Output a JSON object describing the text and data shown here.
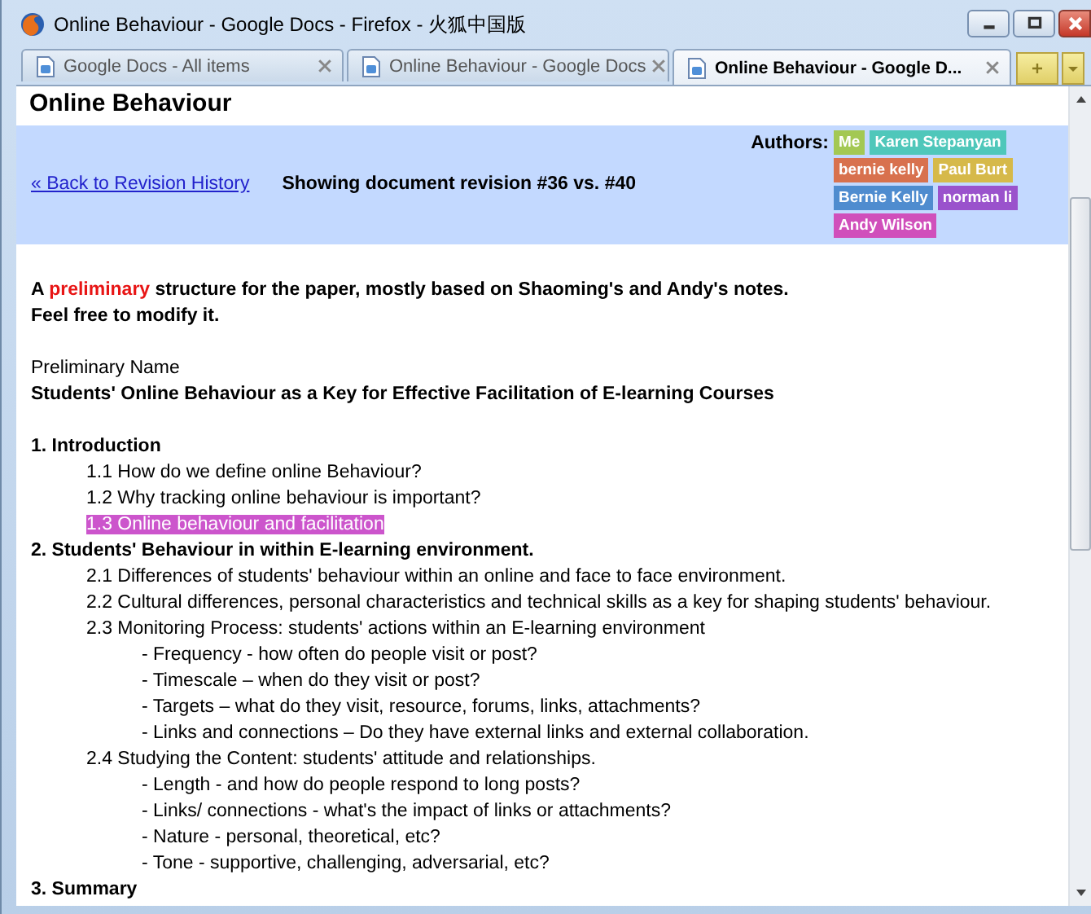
{
  "window": {
    "title": "Online Behaviour - Google Docs - Firefox - 火狐中国版"
  },
  "tabs": [
    {
      "label": "Google Docs - All items",
      "selected": false
    },
    {
      "label": "Online Behaviour - Google Docs",
      "selected": false
    },
    {
      "label": "Online Behaviour - Google D...",
      "selected": true
    }
  ],
  "page": {
    "heading": "Online Behaviour",
    "revision_bar": {
      "back_link": "« Back to Revision History",
      "revision": "Showing document revision #36 vs. #40",
      "authors_label": "Authors:",
      "authors": [
        {
          "name": "Me",
          "color": "#a3c853"
        },
        {
          "name": "Karen Stepanyan",
          "color": "#4fc7ba"
        },
        {
          "name": "bernie kelly",
          "color": "#d8714e"
        },
        {
          "name": "Paul Burt",
          "color": "#d6b94a"
        },
        {
          "name": "Bernie Kelly",
          "color": "#4f8ccf"
        },
        {
          "name": "norman li",
          "color": "#9a52cc"
        },
        {
          "name": "Andy Wilson",
          "color": "#d04fbb"
        }
      ]
    },
    "intro": {
      "before": "A ",
      "emphasis": "preliminary",
      "after": " structure for the paper, mostly based on Shaoming's and Andy's notes."
    },
    "intro_2": "Feel free to modify it.",
    "name_label": "Preliminary Name",
    "paper_title": "Students' Online Behaviour as a Key for Effective Facilitation of E-learning Courses",
    "outline": [
      {
        "text": "1. Introduction",
        "highlighted": false,
        "children": [
          {
            "text": "1.1 How do we define online Behaviour?",
            "highlighted": false
          },
          {
            "text": "1.2 Why tracking online behaviour is important?",
            "highlighted": false
          },
          {
            "text": "1.3 Online behaviour and facilitation",
            "highlighted": true
          }
        ]
      },
      {
        "text": "2. Students' Behaviour in within E-learning environment.",
        "highlighted": false,
        "children": [
          {
            "text": "2.1 Differences of students' behaviour within an online and face to face environment.",
            "highlighted": false
          },
          {
            "text": "2.2 Cultural differences, personal characteristics and technical skills as a key for shaping students' behaviour.",
            "highlighted": false
          },
          {
            "text": "2.3 Monitoring Process: students' actions within  an E-learning environment",
            "highlighted": false,
            "children": [
              {
                "text": "- Frequency - how often do people visit or post?",
                "highlighted": false
              },
              {
                "text": "- Timescale – when do they visit or post?",
                "highlighted": false
              },
              {
                "text": "- Targets – what do they visit, resource, forums, links, attachments?",
                "highlighted": false
              },
              {
                "text": "- Links and connections – Do they have external links and external collaboration.",
                "highlighted": false
              }
            ]
          },
          {
            "text": "2.4 Studying the Content: students' attitude and relationships.",
            "highlighted": false,
            "children": [
              {
                "text": "- Length - and how do people respond to long posts?",
                "highlighted": false
              },
              {
                "text": "- Links/ connections - what's the impact of links or attachments?",
                "highlighted": false
              },
              {
                "text": "- Nature - personal, theoretical, etc?",
                "highlighted": false
              },
              {
                "text": "- Tone - supportive, challenging, adversarial, etc?",
                "highlighted": false
              }
            ]
          }
        ]
      },
      {
        "text": "3. Summary",
        "highlighted": false
      }
    ]
  }
}
